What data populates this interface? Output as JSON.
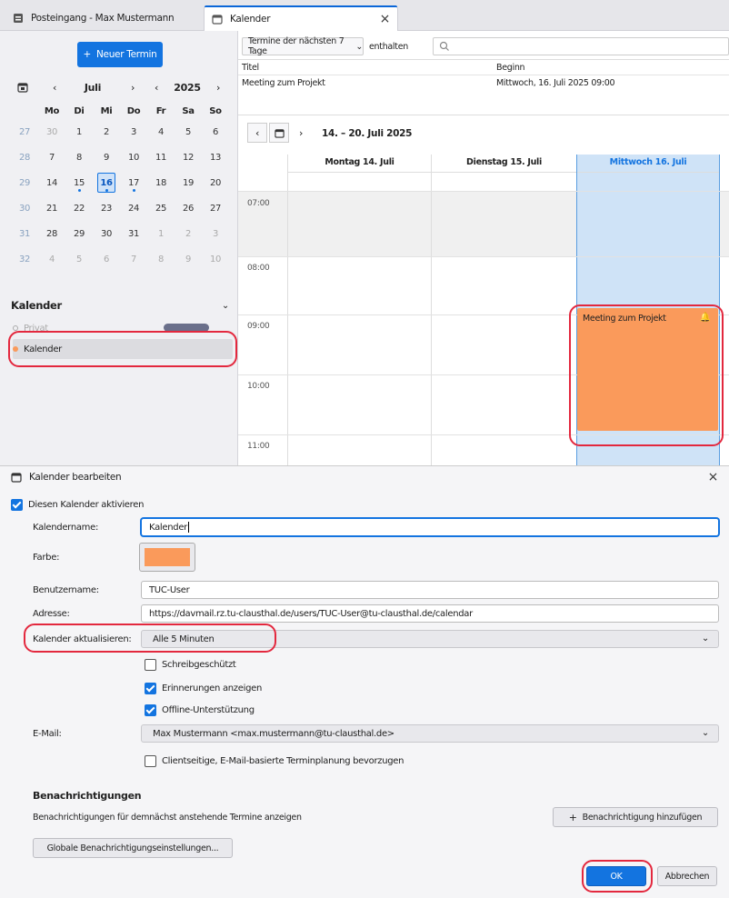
{
  "tabs": [
    {
      "label": "Posteingang - Max Mustermann"
    },
    {
      "label": "Kalender"
    }
  ],
  "sidebar": {
    "new_event_label": "Neuer Termin",
    "month": "Juli",
    "year": "2025",
    "weekdays": [
      "Mo",
      "Di",
      "Mi",
      "Do",
      "Fr",
      "Sa",
      "So"
    ],
    "weeks": [
      {
        "wk": "27",
        "days": [
          "30",
          "1",
          "2",
          "3",
          "4",
          "5",
          "6"
        ]
      },
      {
        "wk": "28",
        "days": [
          "7",
          "8",
          "9",
          "10",
          "11",
          "12",
          "13"
        ]
      },
      {
        "wk": "29",
        "days": [
          "14",
          "15",
          "16",
          "17",
          "18",
          "19",
          "20"
        ]
      },
      {
        "wk": "30",
        "days": [
          "21",
          "22",
          "23",
          "24",
          "25",
          "26",
          "27"
        ]
      },
      {
        "wk": "31",
        "days": [
          "28",
          "29",
          "30",
          "31",
          "1",
          "2",
          "3"
        ]
      },
      {
        "wk": "32",
        "days": [
          "4",
          "5",
          "6",
          "7",
          "8",
          "9",
          "10"
        ]
      }
    ],
    "calendars_heading": "Kalender",
    "calendars": [
      {
        "name": "Privat",
        "color": "#b8b8c0"
      },
      {
        "name": "Kalender",
        "color": "#fa9a5b"
      }
    ]
  },
  "main": {
    "filter_select": "Termine der nächsten 7 Tage",
    "filter_label": "enthalten",
    "list_headers": {
      "title": "Titel",
      "start": "Beginn"
    },
    "list_rows": [
      {
        "title": "Meeting zum Projekt",
        "start": "Mittwoch, 16. Juli 2025 09:00"
      }
    ],
    "week_range": "14. – 20. Juli 2025",
    "day_headers": [
      "Montag 14. Juli",
      "Dienstag 15. Juli",
      "Mittwoch 16. Juli"
    ],
    "hours": [
      "07:00",
      "08:00",
      "09:00",
      "10:00",
      "11:00"
    ],
    "event_title": "Meeting zum Projekt"
  },
  "dialog": {
    "title": "Kalender bearbeiten",
    "enable_label": "Diesen Kalender aktivieren",
    "name_label": "Kalendername:",
    "name_value": "Kalender",
    "color_label": "Farbe:",
    "color_value": "#fa9a5b",
    "user_label": "Benutzername:",
    "user_value": "TUC-User",
    "address_label": "Adresse:",
    "address_value": "https://davmail.rz.tu-clausthal.de/users/TUC-User@tu-clausthal.de/calendar",
    "refresh_label": "Kalender aktualisieren:",
    "refresh_value": "Alle 5 Minuten",
    "readonly_label": "Schreibgeschützt",
    "reminders_label": "Erinnerungen anzeigen",
    "offline_label": "Offline-Unterstützung",
    "email_label": "E-Mail:",
    "email_value": "Max Mustermann <max.mustermann@tu-clausthal.de>",
    "clientside_label": "Clientseitige, E-Mail-basierte Terminplanung bevorzugen",
    "notifications_heading": "Benachrichtigungen",
    "notifications_desc": "Benachrichtigungen für demnächst anstehende Termine anzeigen",
    "add_notification_label": "Benachrichtigung hinzufügen",
    "global_notifications_label": "Globale Benachrichtigungseinstellungen...",
    "ok_label": "OK",
    "cancel_label": "Abbrechen"
  },
  "colors": {
    "accent": "#1374e0",
    "event": "#fa9a5b",
    "highlight_ring": "#e3283e",
    "today_column": "#cfe3f7"
  }
}
